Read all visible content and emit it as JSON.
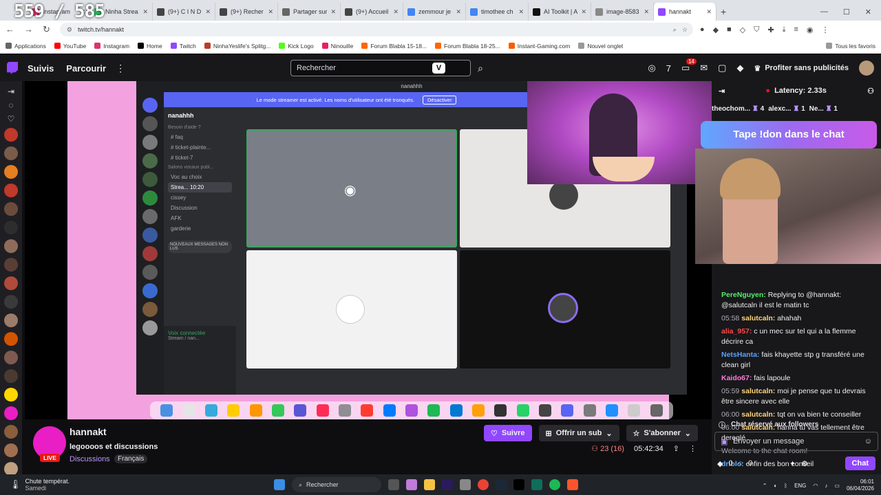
{
  "overlay": {
    "fps": "559 / 585"
  },
  "browser": {
    "tabs": [
      {
        "label": "Instagram",
        "color": "#e1306c"
      },
      {
        "label": "Ninha Strea",
        "color": "#22c55e"
      },
      {
        "label": "(9+) C I N D",
        "color": "#444"
      },
      {
        "label": "(9+) Recher",
        "color": "#444"
      },
      {
        "label": "Partager sur",
        "color": "#666"
      },
      {
        "label": "(9+) Accueil",
        "color": "#444"
      },
      {
        "label": "zemmour je",
        "color": "#4285f4"
      },
      {
        "label": "timothee ch",
        "color": "#4285f4"
      },
      {
        "label": "AI Toolkit | A",
        "color": "#111"
      },
      {
        "label": "image-8583",
        "color": "#888"
      },
      {
        "label": "hannakt",
        "color": "#9147ff"
      }
    ],
    "url": "twitch.tv/hannakt",
    "bookmarks": [
      {
        "label": "Applications",
        "color": "#666"
      },
      {
        "label": "YouTube",
        "color": "#ff0000"
      },
      {
        "label": "Instagram",
        "color": "#e1306c"
      },
      {
        "label": "Home",
        "color": "#000"
      },
      {
        "label": "Twitch",
        "color": "#9147ff"
      },
      {
        "label": "NinhaYeslife's Splitg...",
        "color": "#c0392b"
      },
      {
        "label": "Kick Logo",
        "color": "#53fc18"
      },
      {
        "label": "Ninouille",
        "color": "#e91e63"
      },
      {
        "label": "Forum Blabla 15-18...",
        "color": "#ff6600"
      },
      {
        "label": "Forum Blabla 18-25...",
        "color": "#ff6600"
      },
      {
        "label": "Instant-Gaming.com",
        "color": "#ff5a00"
      },
      {
        "label": "Nouvel onglet",
        "color": "#999"
      }
    ],
    "bookmarks_right": "Tous les favoris"
  },
  "twitch": {
    "nav": {
      "following": "Suivis",
      "browse": "Parcourir"
    },
    "search_placeholder": "Rechercher",
    "notif_count": "14",
    "prime": "Profiter sans publicités",
    "sidebar_avatars": [
      "#c0392b",
      "#7a5c4a",
      "#e67e22",
      "#c0392b",
      "#6b4c3b",
      "#2d2d2d",
      "#8e6c5a",
      "#5a3e36",
      "#b04a3a",
      "#3a3a3a",
      "#9c7b6b",
      "#d35400",
      "#7f5a50",
      "#4a3a30",
      "#ffd700",
      "#e91ec4",
      "#8b5e3c",
      "#a07050",
      "#c0a080"
    ]
  },
  "stream": {
    "discord": {
      "top_title": "nanahhh",
      "banner": "Le mode streamer est activé. Les noms d'utilisateur ont été tronqués.",
      "banner_btn": "Désactiver",
      "server_name": "nanahhh",
      "channels": [
        {
          "label": "Besoin d'aide ?",
          "type": "cat"
        },
        {
          "label": "# faq",
          "type": "ch"
        },
        {
          "label": "# ticket-plainte...",
          "type": "ch"
        },
        {
          "label": "# ticket-7",
          "type": "ch"
        },
        {
          "label": "Salons vocaux publ...",
          "type": "cat"
        },
        {
          "label": "Voc au choix",
          "type": "ch"
        },
        {
          "label": "Strea...  10:20",
          "type": "sel"
        },
        {
          "label": "cissey",
          "type": "ch"
        },
        {
          "label": "Discussion",
          "type": "ch"
        },
        {
          "label": "AFK",
          "type": "ch"
        },
        {
          "label": "garderie",
          "type": "ch"
        }
      ],
      "new_msgs": "NOUVEAUX MESSAGES NON LUS",
      "voice": "Voix connectée",
      "voice_sub": "Stream / nan..."
    }
  },
  "chat": {
    "latency": "Latency: 2.33s",
    "subs": [
      {
        "name": "theochom...",
        "count": "4"
      },
      {
        "name": "alexc...",
        "count": "1"
      },
      {
        "name": "Ne...",
        "count": "1"
      }
    ],
    "banner": "Tape !don dans le chat",
    "messages": [
      {
        "time": "",
        "user": "PereNguyen:",
        "text": "Replying to @hannakt: @salutcaln il est le matin tc",
        "color": "#54f06b"
      },
      {
        "time": "05:58",
        "user": "salutcaln:",
        "text": "ahahah",
        "color": "#ffd37a"
      },
      {
        "time": "",
        "user": "alia_957:",
        "text": "c un mec sur tel qui a la flemme décrire ca",
        "color": "#ff4a4a"
      },
      {
        "time": "",
        "user": "NetsHanta:",
        "text": "fais khayette stp g transféré une clean girl",
        "color": "#5aa0ff"
      },
      {
        "time": "",
        "user": "Kaido67:",
        "text": "fais lapoule",
        "color": "#ff7ad9"
      },
      {
        "time": "05:59",
        "user": "salutcaln:",
        "text": "moi je pense que tu devrais être sincere avec elle",
        "color": "#ffd37a"
      },
      {
        "time": "06:00",
        "user": "salutcaln:",
        "text": "tqt on va bien te conseiller",
        "color": "#ffd37a"
      },
      {
        "time": "06:00",
        "user": "salutcaln:",
        "text": "hanna tu vas tellement être dereglé",
        "color": "#ffd37a"
      },
      {
        "time": "",
        "user": "",
        "text": "Welcome to the chat room!",
        "color": "#adadb8"
      },
      {
        "time": "",
        "user": "driblo:",
        "text": "enfin des bon conseil",
        "color": "#5ab0ff"
      }
    ],
    "followers_only": "Chat réservé aux followers",
    "input_placeholder": "Envoyer un message",
    "points_a": "0",
    "points_b": "0",
    "send": "Chat"
  },
  "channel": {
    "name": "hannakt",
    "live": "LIVE",
    "title": "legoooos et discussions",
    "category": "Discussions",
    "tag": "Français",
    "follow": "Suivre",
    "gift": "Offrir un sub",
    "subscribe": "S'abonner",
    "viewers": "23 (16)",
    "uptime": "05:42:34"
  },
  "taskbar": {
    "weather": "Chute températ.",
    "weather_sub": "Samedi",
    "search": "Rechercher",
    "lang": "ENG",
    "time": "06:01",
    "date": "06/04/2026"
  }
}
